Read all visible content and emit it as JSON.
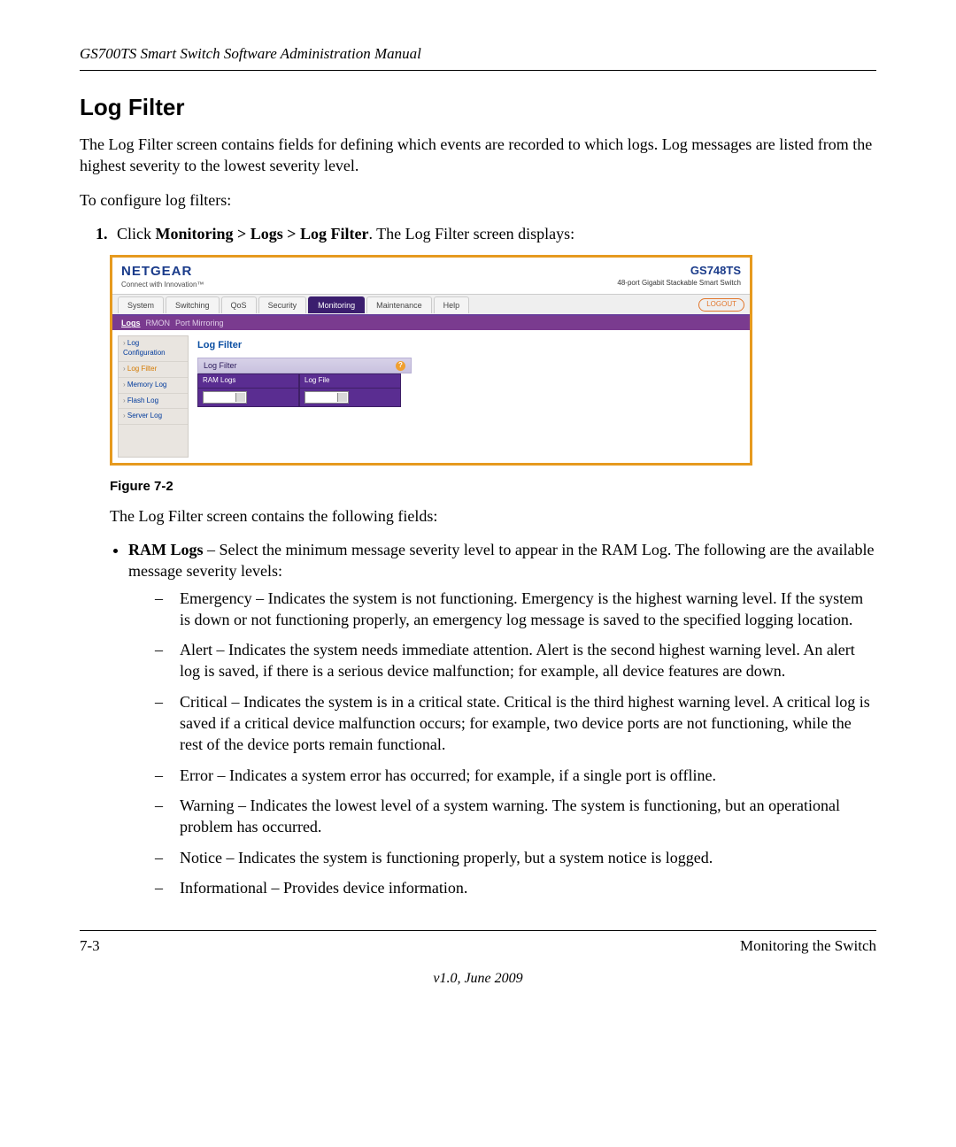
{
  "header_title": "GS700TS Smart Switch Software Administration Manual",
  "section_heading": "Log Filter",
  "intro_para": "The Log Filter screen contains fields for defining which events are recorded to which logs. Log messages are listed from the highest severity to the lowest severity level.",
  "configure_line": "To configure log filters:",
  "step_num": "1.",
  "step_prefix": "Click ",
  "step_bold": "Monitoring > Logs > Log Filter",
  "step_suffix": ". The Log Filter screen displays:",
  "figure_caption": "Figure 7-2",
  "after_figure": "The Log Filter screen contains the following fields:",
  "bullet_bold": "RAM Logs",
  "bullet_rest": " – Select the minimum message severity level to appear in the RAM Log. The following are the available message severity levels:",
  "severities": [
    "Emergency – Indicates the system is not functioning. Emergency is the highest warning level. If the system is down or not functioning properly, an emergency log message is saved to the specified logging location.",
    "Alert – Indicates the system needs immediate attention. Alert is the second highest warning level. An alert log is saved, if there is a serious device malfunction; for example, all device features are down.",
    "Critical – Indicates the system is in a critical state. Critical is the third highest warning level. A critical log is saved if a critical device malfunction occurs; for example, two device ports are not functioning, while the rest of the device ports remain functional.",
    "Error – Indicates a system error has occurred; for example, if a single port is offline.",
    "Warning – Indicates the lowest level of a system warning. The system is functioning, but an operational problem has occurred.",
    "Notice – Indicates the system is functioning properly, but a system notice is logged.",
    "Informational – Provides device information."
  ],
  "footer_left": "7-3",
  "footer_right": "Monitoring the Switch",
  "footer_version": "v1.0, June 2009",
  "fig": {
    "brand": "NETGEAR",
    "brand_sub": "Connect with Innovation™",
    "model": "GS748TS",
    "model_desc": "48-port Gigabit Stackable Smart Switch",
    "tabs": [
      "System",
      "Switching",
      "QoS",
      "Security",
      "Monitoring",
      "Maintenance",
      "Help"
    ],
    "active_tab": "Monitoring",
    "logout": "LOGOUT",
    "subtabs": [
      "Logs",
      "RMON",
      "Port Mirroring"
    ],
    "active_subtab": "Logs",
    "side_items": [
      "Log Configuration",
      "Log Filter",
      "Memory Log",
      "Flash Log",
      "Server Log"
    ],
    "side_active": "Log Filter",
    "panel_title": "Log Filter",
    "panel_sub": "Log Filter",
    "col1": "RAM Logs",
    "col2": "Log File"
  }
}
